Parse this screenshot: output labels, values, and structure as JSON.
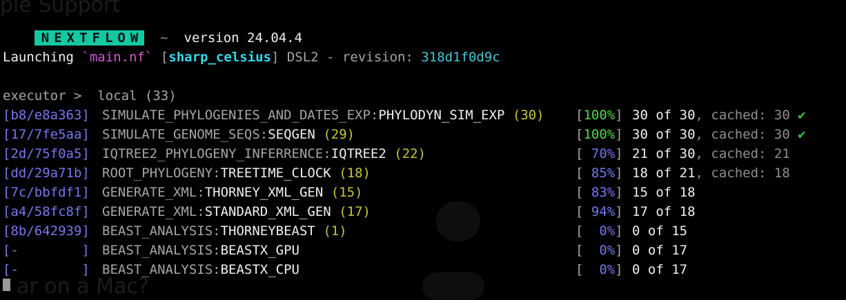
{
  "header": {
    "logo": "NEXTFLOW",
    "tilde": "~",
    "version_text": "version 24.04.4"
  },
  "launch": {
    "prefix": "Launching ",
    "script": "`main.nf`",
    "run_name_open": "[",
    "run_name": "sharp_celsius",
    "run_name_close": "]",
    "dsl": " DSL2 - ",
    "revision_label": "revision: ",
    "revision": "318d1f0d9c"
  },
  "executor": {
    "label": "executor >  ",
    "value": "local (33)"
  },
  "processes": [
    {
      "hash": "[b8/e8a363]",
      "group": "SIMULATE_PHYLOGENIES_AND_DATES_EXP:",
      "name": "PHYLODYN_SIM_EXP",
      "count": "(30)",
      "pct_open": "[",
      "pct": "100%",
      "pct_close": "]",
      "progress": "30 of 30",
      "cached_sep": ", cached: 30",
      "check": "✔"
    },
    {
      "hash": "[17/7fe5aa]",
      "group": "SIMULATE_GENOME_SEQS:",
      "name": "SEQGEN",
      "count": "(29)",
      "pct_open": "[",
      "pct": "100%",
      "pct_close": "]",
      "progress": "30 of 30",
      "cached_sep": ", cached: 30",
      "check": "✔"
    },
    {
      "hash": "[2d/75f0a5]",
      "group": "IQTREE2_PHYLOGENY_INFERRENCE:",
      "name": "IQTREE2",
      "count": "(22)",
      "pct_open": "[",
      "pct": " 70%",
      "pct_close": "]",
      "progress": "21 of 30",
      "cached_sep": ", cached: 21",
      "check": ""
    },
    {
      "hash": "[dd/29a71b]",
      "group": "ROOT_PHYLOGENY:",
      "name": "TREETIME_CLOCK",
      "count": "(18)",
      "pct_open": "[",
      "pct": " 85%",
      "pct_close": "]",
      "progress": "18 of 21",
      "cached_sep": ", cached: 18",
      "check": ""
    },
    {
      "hash": "[7c/bbfdf1]",
      "group": "GENERATE_XML:",
      "name": "THORNEY_XML_GEN",
      "count": "(15)",
      "pct_open": "[",
      "pct": " 83%",
      "pct_close": "]",
      "progress": "15 of 18",
      "cached_sep": "",
      "check": ""
    },
    {
      "hash": "[a4/58fc8f]",
      "group": "GENERATE_XML:",
      "name": "STANDARD_XML_GEN",
      "count": "(17)",
      "pct_open": "[",
      "pct": " 94%",
      "pct_close": "]",
      "progress": "17 of 18",
      "cached_sep": "",
      "check": ""
    },
    {
      "hash": "[8b/642939]",
      "group": "BEAST_ANALYSIS:",
      "name": "THORNEYBEAST",
      "count": "(1)",
      "pct_open": "[",
      "pct": "  0%",
      "pct_close": "]",
      "progress": "0 of 15",
      "cached_sep": "",
      "check": ""
    },
    {
      "hash": "[-        ]",
      "group": "BEAST_ANALYSIS:",
      "name": "BEASTX_GPU",
      "count": "",
      "pct_open": "[",
      "pct": "  0%",
      "pct_close": "]",
      "progress": "0 of 17",
      "cached_sep": "",
      "check": ""
    },
    {
      "hash": "[-        ]",
      "group": "BEAST_ANALYSIS:",
      "name": "BEASTX_CPU",
      "count": "",
      "pct_open": "[",
      "pct": "  0%",
      "pct_close": "]",
      "progress": "0 of 17",
      "cached_sep": "",
      "check": ""
    }
  ],
  "background": {
    "title_fragment": "ple Support",
    "footer_fragment": "ar on a Mac?"
  }
}
